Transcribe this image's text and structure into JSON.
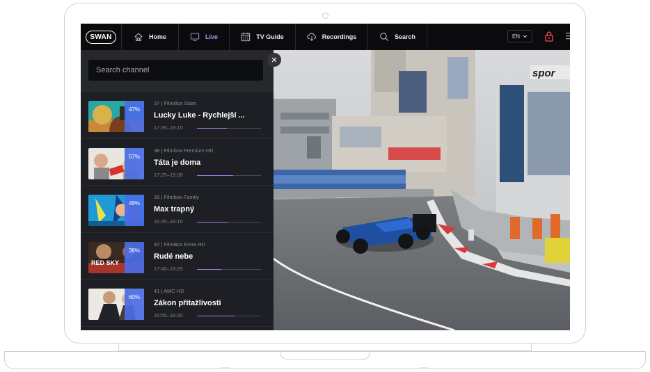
{
  "nav": {
    "logo": "SWAN",
    "items": [
      {
        "label": "Home",
        "icon": "home-icon"
      },
      {
        "label": "Live",
        "icon": "tv-icon"
      },
      {
        "label": "TV Guide",
        "icon": "calendar-icon"
      },
      {
        "label": "Recordings",
        "icon": "cloud-download-icon"
      },
      {
        "label": "Search",
        "icon": "search-icon"
      }
    ],
    "active": "Live",
    "language": "EN"
  },
  "sidebar": {
    "search_placeholder": "Search channel",
    "channels": [
      {
        "meta": "37 | FilmBox Stars",
        "title": "Lucky Luke - Rychlejší ...",
        "time": "17:35–19:15",
        "progress": "47%"
      },
      {
        "meta": "38 | Filmbox Premium HD",
        "title": "Táta je doma",
        "time": "17:25–19:00",
        "progress": "57%"
      },
      {
        "meta": "39 | Filmbox Family",
        "title": "Max trapný",
        "time": "16:35–18:15",
        "progress": "49%"
      },
      {
        "meta": "40 | FilmBox Extra HD",
        "title": "Rudé nebe",
        "time": "17:40–19:25",
        "progress": "38%"
      },
      {
        "meta": "41 | AMC HD",
        "title": "Zákon přitažlivosti",
        "time": "16:55–18:30",
        "progress": "60%"
      }
    ]
  },
  "video": {
    "channel_logo_text": "spor"
  },
  "colors": {
    "accent": "#b58ff0",
    "badge": "#4a6ce6",
    "background": "#1d1f24"
  }
}
